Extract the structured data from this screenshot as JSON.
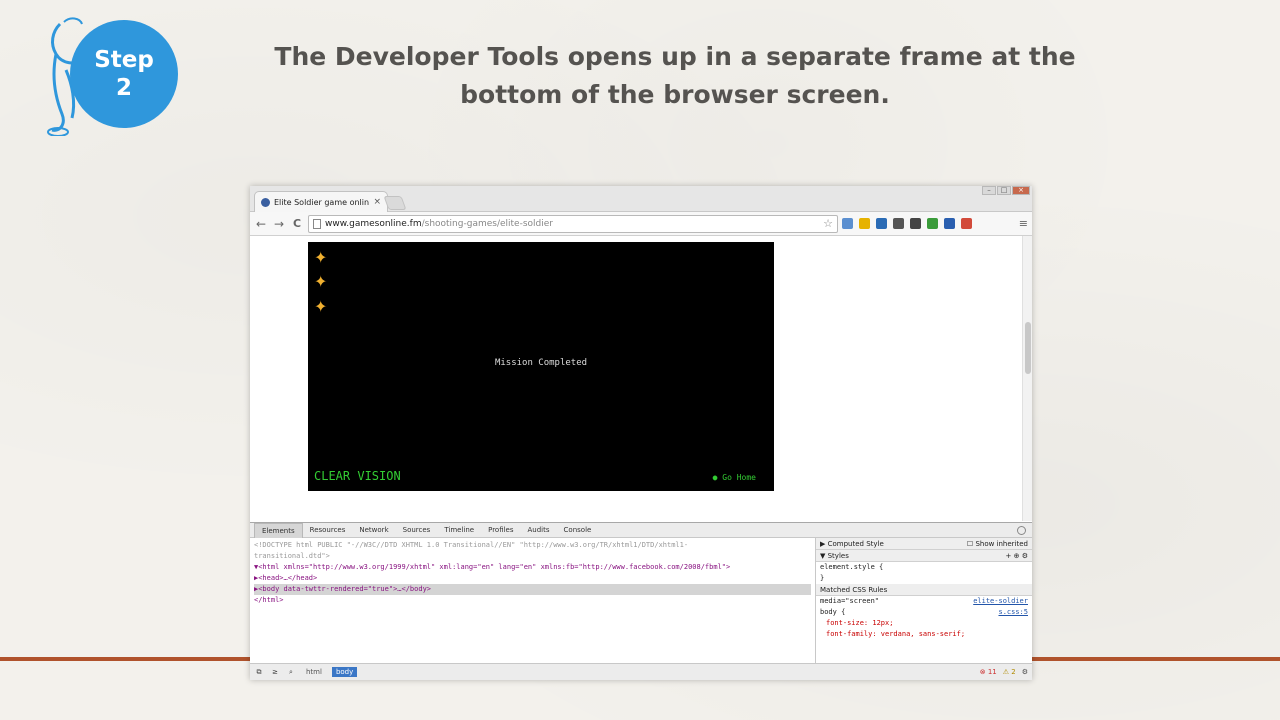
{
  "slide": {
    "step_label_line1": "Step",
    "step_label_line2": "2",
    "title": "The Developer Tools opens up in a separate frame at the bottom of the browser screen.",
    "accent_color": "#2f97dc",
    "rule_color": "#b0532c"
  },
  "browser": {
    "tab_title": "Elite Soldier game online",
    "tab_close": "×",
    "url_host": "www.gamesonline.fm",
    "url_path": "/shooting-games/elite-soldier",
    "nav": {
      "back": "←",
      "forward": "→",
      "reload": "C"
    },
    "extension_colors": [
      "#5b8fd0",
      "#e6b200",
      "#2a6bb5",
      "#555555",
      "#444444",
      "#3a9b3a",
      "#2a5fb0",
      "#d24a3a"
    ],
    "menu_icon": "≡"
  },
  "game": {
    "stars": [
      "✦",
      "✦",
      "✦"
    ],
    "message": "Mission Completed",
    "brand": "CLEAR VISION",
    "home_link": "Go Home"
  },
  "devtools": {
    "tabs": [
      "Elements",
      "Resources",
      "Network",
      "Sources",
      "Timeline",
      "Profiles",
      "Audits",
      "Console"
    ],
    "active_tab": "Elements",
    "dom_lines": [
      "<!DOCTYPE html PUBLIC \"-//W3C//DTD XHTML 1.0 Transitional//EN\" \"http://www.w3.org/TR/xhtml1/DTD/xhtml1-",
      "transitional.dtd\">",
      "▼<html xmlns=\"http://www.w3.org/1999/xhtml\" xml:lang=\"en\" lang=\"en\" xmlns:fb=\"http://www.facebook.com/2008/fbml\">",
      "  ▶<head>…</head>",
      "  ▶<body data-twttr-rendered=\"true\">…</body>",
      "</html>"
    ],
    "styles": {
      "computed_header": "▶ Computed Style",
      "show_inherited": "Show inherited",
      "styles_header": "▼ Styles",
      "element_style": "element.style {",
      "close_brace": "}",
      "matched_header": "Matched CSS Rules",
      "media": "media=\"screen\"",
      "media_link": "elite-soldier",
      "selector": "body {",
      "selector_link": "s.css:5",
      "props": [
        "font-size: 12px;",
        "font-family: verdana, sans-serif;"
      ]
    },
    "footer": {
      "crumbs": [
        "html",
        "body"
      ],
      "active_crumb": "body",
      "errors": "11",
      "warnings": "2"
    }
  }
}
